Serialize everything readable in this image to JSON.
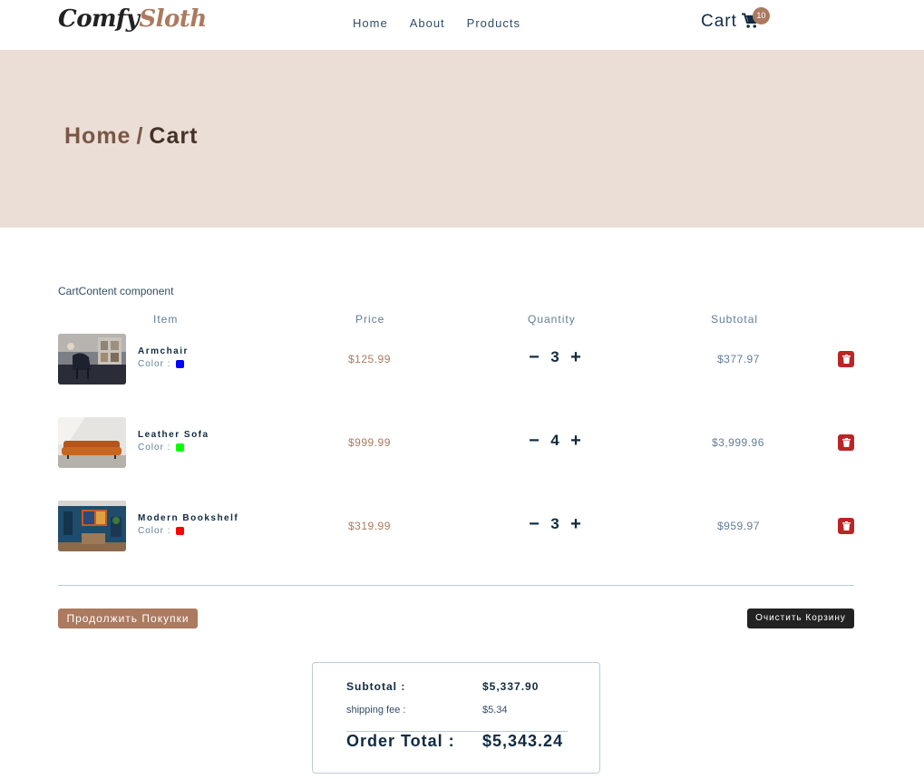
{
  "navbar": {
    "logo_part1": "Comfy",
    "logo_part2": "Sloth",
    "links": [
      "Home",
      "About",
      "Products"
    ],
    "cart_label": "Cart",
    "cart_count": "10",
    "cart_icon": "shopping-cart-icon"
  },
  "hero": {
    "crumb_home": "Home",
    "crumb_sep": "/",
    "crumb_current": "Cart"
  },
  "cart": {
    "component_label": "CartContent component",
    "columns": {
      "item": "Item",
      "price": "Price",
      "quantity": "Quantity",
      "subtotal": "Subtotal"
    },
    "color_label": "Color :",
    "items": [
      {
        "name": "Armchair",
        "color": "#0000ff",
        "price": "$125.99",
        "quantity": "3",
        "subtotal": "$377.97"
      },
      {
        "name": "Leather Sofa",
        "color": "#00ff00",
        "price": "$999.99",
        "quantity": "4",
        "subtotal": "$3,999.96"
      },
      {
        "name": "Modern Bookshelf",
        "color": "#ff0000",
        "price": "$319.99",
        "quantity": "3",
        "subtotal": "$959.97"
      }
    ],
    "decrease": "−",
    "increase": "+",
    "continue_label": "Продолжить Покупки",
    "clear_label": "Очистить Корзину"
  },
  "totals": {
    "subtotal_label": "Subtotal :",
    "subtotal_value": "$5,337.90",
    "shipping_label": "shipping fee :",
    "shipping_value": "$5.34",
    "order_total_label": "Order Total :",
    "order_total_value": "$5,343.24"
  },
  "colors": {
    "brand": "#ab7a5f",
    "hero_bg": "#eaded7",
    "remove": "#bb2525"
  }
}
